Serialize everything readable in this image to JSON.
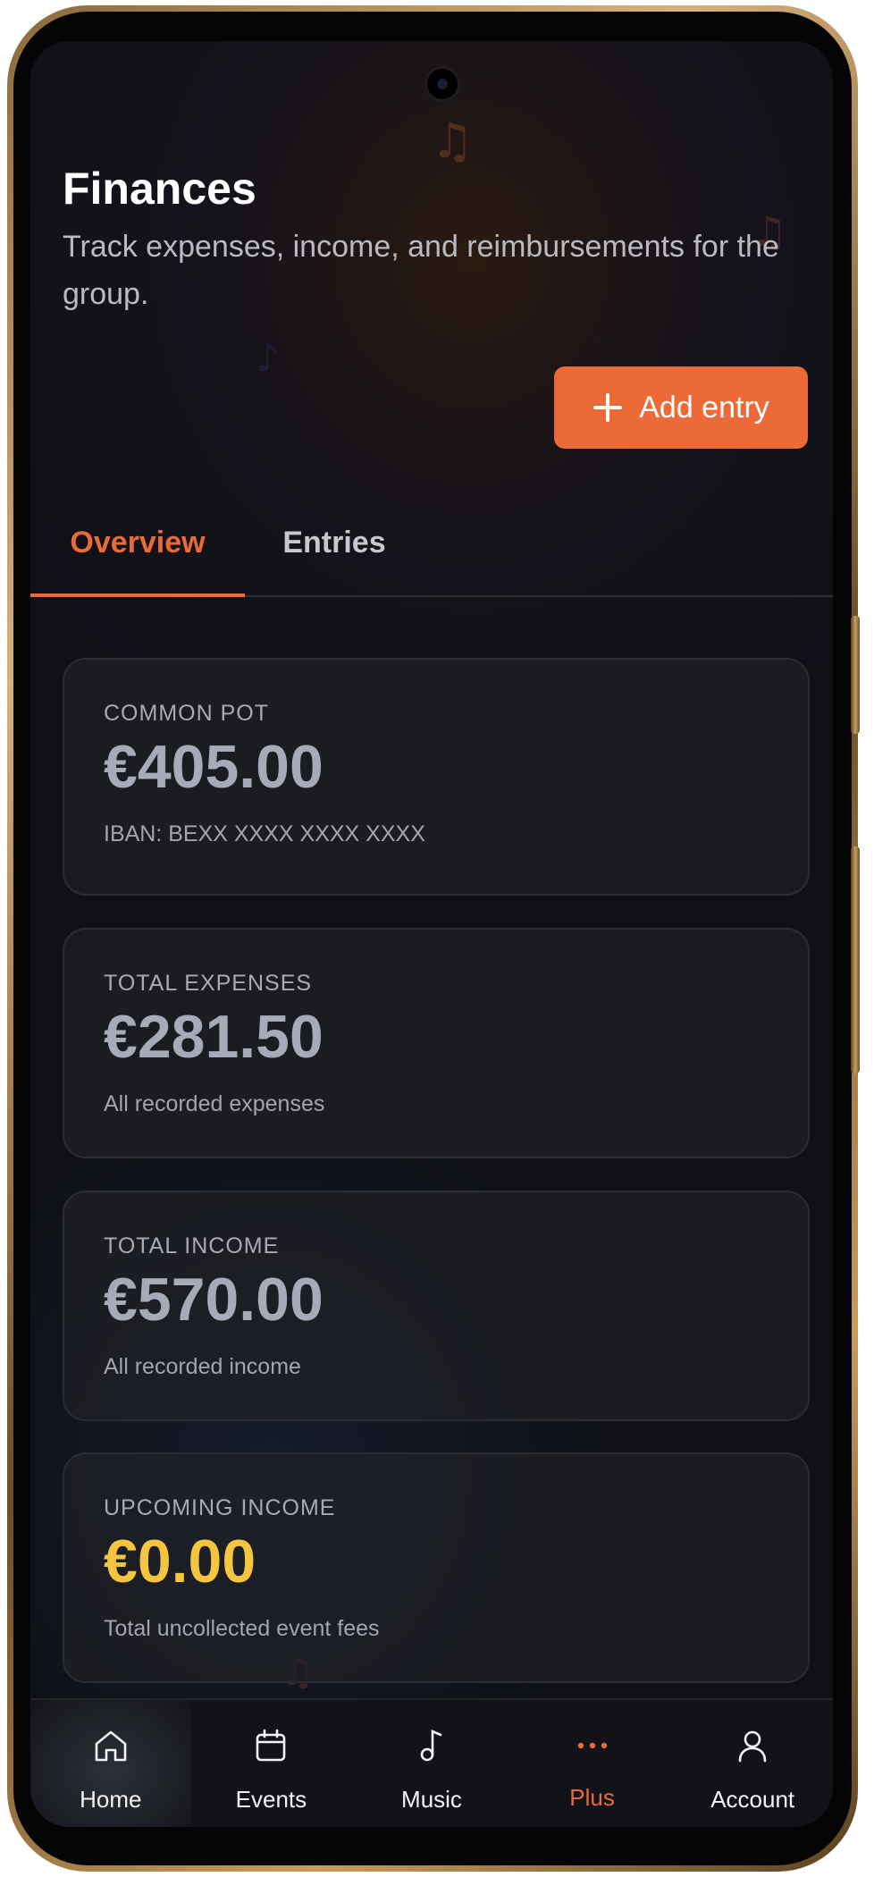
{
  "header": {
    "title": "Finances",
    "subtitle": "Track expenses, income, and reimbursements for the group.",
    "add_button_label": "Add entry"
  },
  "tabs": [
    {
      "label": "Overview",
      "active": true
    },
    {
      "label": "Entries",
      "active": false
    }
  ],
  "cards": [
    {
      "label": "COMMON POT",
      "value": "€405.00",
      "note": "IBAN: BEXX XXXX XXXX XXXX"
    },
    {
      "label": "TOTAL EXPENSES",
      "value": "€281.50",
      "note": "All recorded expenses"
    },
    {
      "label": "TOTAL INCOME",
      "value": "€570.00",
      "note": "All recorded income"
    },
    {
      "label": "UPCOMING INCOME",
      "value": "€0.00",
      "note": "Total uncollected event fees"
    }
  ],
  "bottom_nav": [
    {
      "label": "Home",
      "icon": "home-icon",
      "active": false
    },
    {
      "label": "Events",
      "icon": "calendar-icon",
      "active": false
    },
    {
      "label": "Music",
      "icon": "music-note-icon",
      "active": false
    },
    {
      "label": "Plus",
      "icon": "more-dots-icon",
      "active": true
    },
    {
      "label": "Account",
      "icon": "user-icon",
      "active": false
    }
  ],
  "colors": {
    "accent": "#ec6a37",
    "highlight_value": "#f5c542",
    "background": "#0f1117",
    "card": "#202127"
  }
}
